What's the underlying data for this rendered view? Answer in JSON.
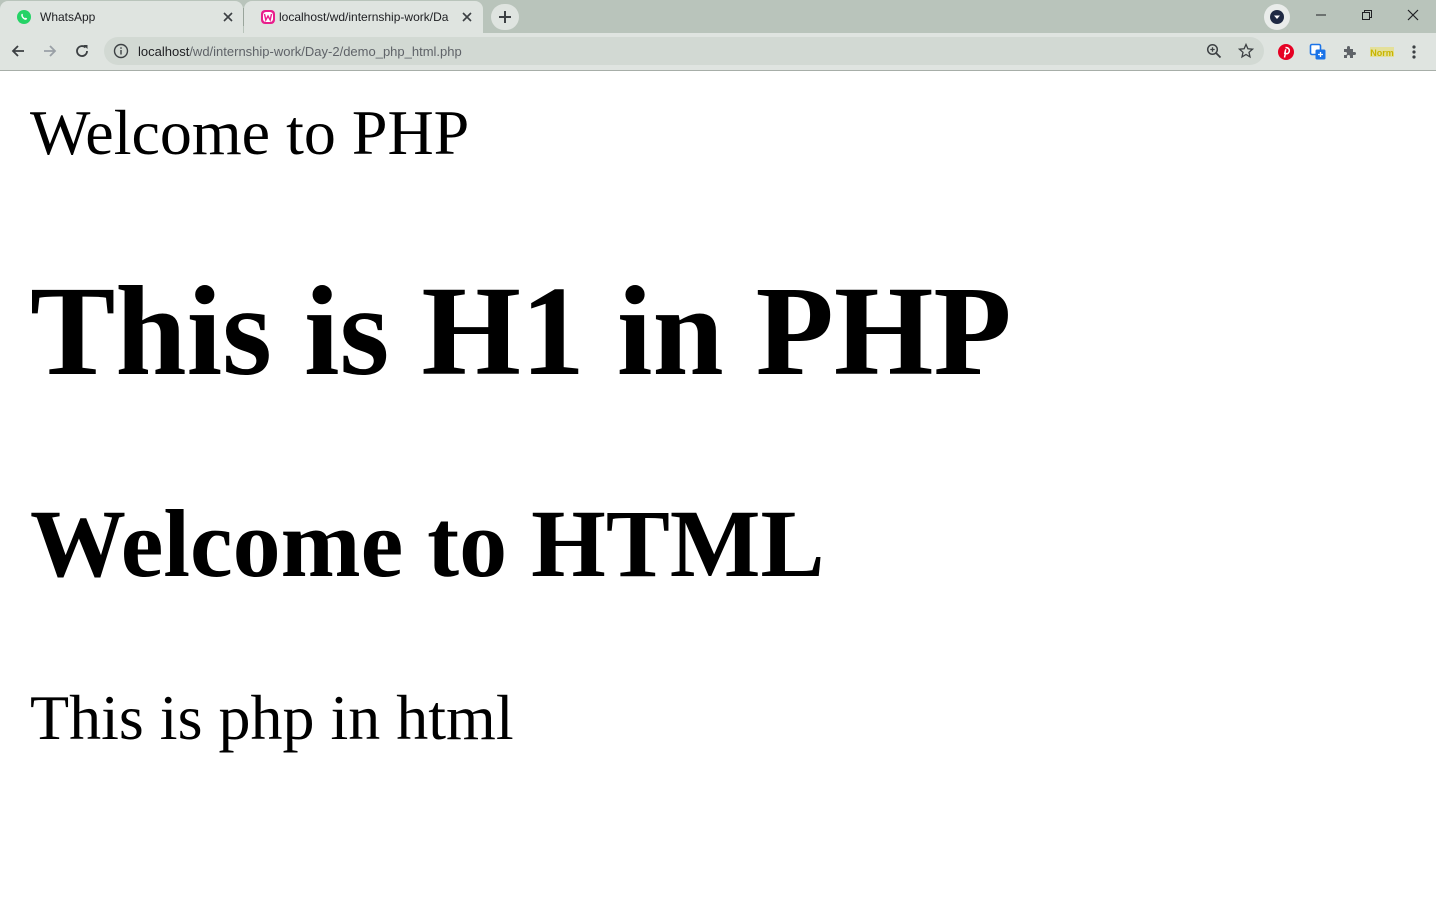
{
  "tabs": [
    {
      "title": "WhatsApp",
      "icon": "whatsapp-icon",
      "icon_color": "#25d366"
    },
    {
      "title": "localhost/wd/internship-work/Da",
      "icon": "wamp-icon",
      "icon_color": "#e91e8c",
      "active": true
    }
  ],
  "toolbar": {
    "url_host": "localhost",
    "url_path": "/wd/internship-work/Day-2/demo_php_html.php"
  },
  "extensions": [
    {
      "name": "pinterest-icon",
      "color": "#e60023"
    },
    {
      "name": "translate-icon",
      "color": "#1a73e8"
    },
    {
      "name": "extensions-puzzle-icon",
      "color": "#5f6368"
    },
    {
      "name": "norm-extension-icon",
      "label": "Norm",
      "color": "#c8b400"
    }
  ],
  "content": {
    "line1": "Welcome to PHP",
    "heading1": "This is H1 in PHP",
    "heading2": "Welcome to HTML",
    "line4": "This is php in html"
  }
}
